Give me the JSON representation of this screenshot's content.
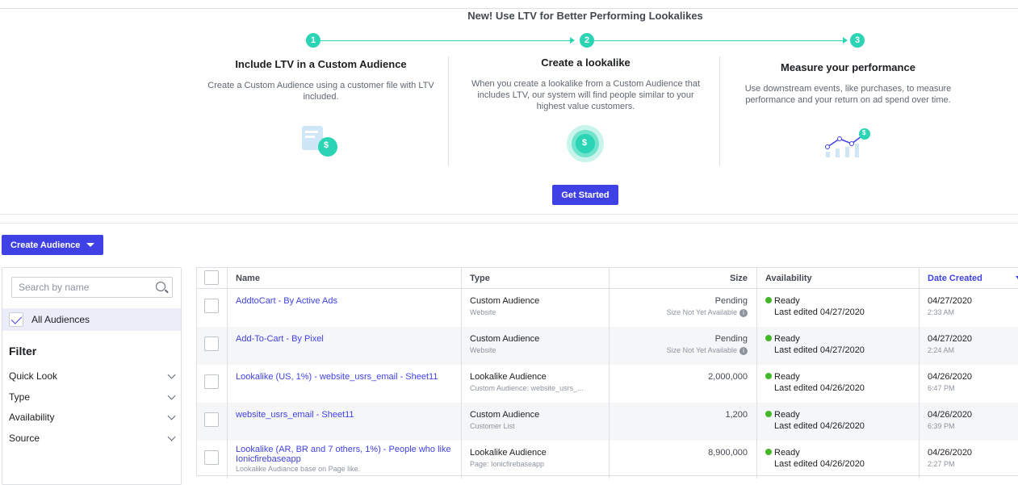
{
  "promo": {
    "title": "New! Use LTV for Better Performing Lookalikes",
    "steps": [
      "1",
      "2",
      "3"
    ],
    "columns": [
      {
        "title": "Include LTV in a Custom Audience",
        "desc": "Create a Custom Audience using a customer file with LTV included.",
        "icon": "customer-file-icon"
      },
      {
        "title": "Create a lookalike",
        "desc": "When you create a lookalike from a Custom Audience that includes LTV, our system will find people similar to your highest value customers.",
        "icon": "dollar-coin-icon"
      },
      {
        "title": "Measure your performance",
        "desc": "Use downstream events, like purchases, to measure performance and your return on ad spend over time.",
        "icon": "performance-chart-icon"
      }
    ],
    "cta": "Get Started",
    "icon_symbol": "$"
  },
  "toolbar": {
    "create_audience": "Create Audience"
  },
  "sidebar": {
    "search_placeholder": "Search by name",
    "all_audiences": "All Audiences",
    "filter_title": "Filter",
    "filters": [
      "Quick Look",
      "Type",
      "Availability",
      "Source"
    ]
  },
  "table": {
    "headers": {
      "name": "Name",
      "type": "Type",
      "size": "Size",
      "availability": "Availability",
      "date": "Date Created"
    },
    "rows": [
      {
        "name": "AddtoCart - By Active Ads",
        "name_sub": "",
        "type": "Custom Audience",
        "type_sub": "Website",
        "size": "Pending",
        "size_sub": "Size Not Yet Available",
        "status": "Ready",
        "edited": "Last edited 04/27/2020",
        "date": "04/27/2020",
        "time": "2:33 AM"
      },
      {
        "name": "Add-To-Cart - By Pixel",
        "name_sub": "",
        "type": "Custom Audience",
        "type_sub": "Website",
        "size": "Pending",
        "size_sub": "Size Not Yet Available",
        "status": "Ready",
        "edited": "Last edited 04/27/2020",
        "date": "04/27/2020",
        "time": "2:24 AM"
      },
      {
        "name": "Lookalike (US, 1%) - website_usrs_email - Sheet11",
        "name_sub": "",
        "type": "Lookalike Audience",
        "type_sub": "Custom Audience: website_usrs_...",
        "size": "2,000,000",
        "size_sub": "",
        "status": "Ready",
        "edited": "Last edited 04/26/2020",
        "date": "04/26/2020",
        "time": "6:47 PM"
      },
      {
        "name": "website_usrs_email - Sheet11",
        "name_sub": "",
        "type": "Custom Audience",
        "type_sub": "Customer List",
        "size": "1,200",
        "size_sub": "",
        "status": "Ready",
        "edited": "Last edited 04/26/2020",
        "date": "04/26/2020",
        "time": "6:39 PM"
      },
      {
        "name": "Lookalike (AR, BR and 7 others, 1%) - People who like Ionicfirebaseapp",
        "name_sub": "Lookalike Audiance base on Page like.",
        "type": "Lookalike Audience",
        "type_sub": "Page: Ionicfirebaseapp",
        "size": "8,900,000",
        "size_sub": "",
        "status": "Ready",
        "edited": "Last edited 04/26/2020",
        "date": "04/26/2020",
        "time": "2:27 PM"
      }
    ]
  },
  "colors": {
    "accent": "#4041e5",
    "teal": "#2bd4b4",
    "ready": "#42b72a"
  }
}
